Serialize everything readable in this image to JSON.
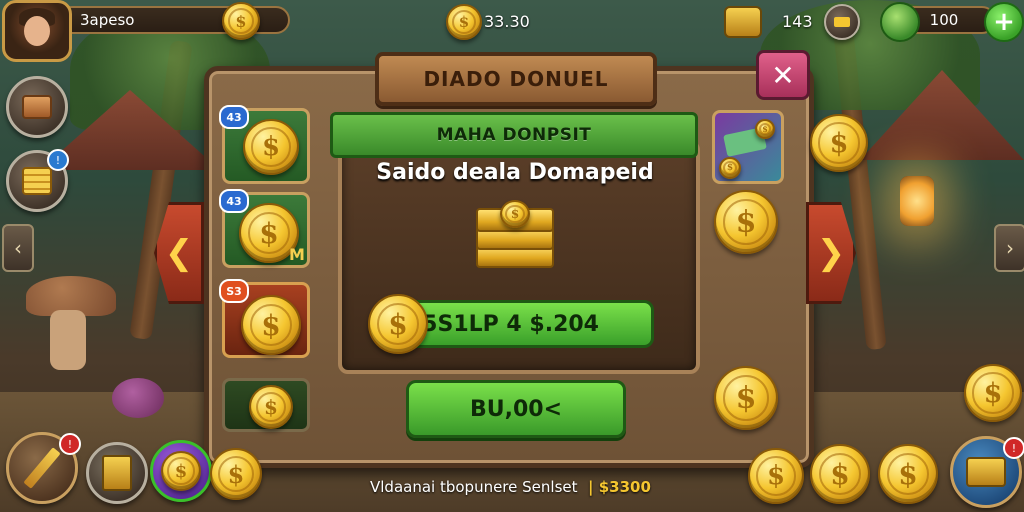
{
  "top_bar": {
    "player_name": "3apeso",
    "center_coins": "33.30",
    "stat_value": "143",
    "gold_value": "100",
    "plus_label": "+"
  },
  "panel": {
    "title": "DIADO DONUEL",
    "close_label": "✕",
    "ribbon": "MAHA DONPSIT",
    "headline": "Saido deala Domapeid",
    "amount": "5S1LP 4 $.204",
    "buy_label": "BU,00<",
    "slots": [
      {
        "badge": "43",
        "extra": ""
      },
      {
        "badge": "43",
        "extra": "M"
      },
      {
        "badge": "S3",
        "extra": ""
      },
      {
        "badge": "",
        "extra": ""
      }
    ],
    "left_arrow": "❮",
    "right_arrow": "❯"
  },
  "footer": {
    "text": "Vldaanai tbopunere Senlset",
    "price": "| $3300"
  },
  "colors": {
    "accent_green": "#3aa02a",
    "gold": "#f5c630",
    "panel_wood": "#8a6a48",
    "close_pink": "#e0608a"
  },
  "icons": [
    "profile-avatar",
    "coin-icon",
    "gold-chest-icon",
    "coin-stack-icon",
    "leaf-icon",
    "pencil-icon",
    "card-icon",
    "gem-pack-icon",
    "treasure-box-icon"
  ]
}
